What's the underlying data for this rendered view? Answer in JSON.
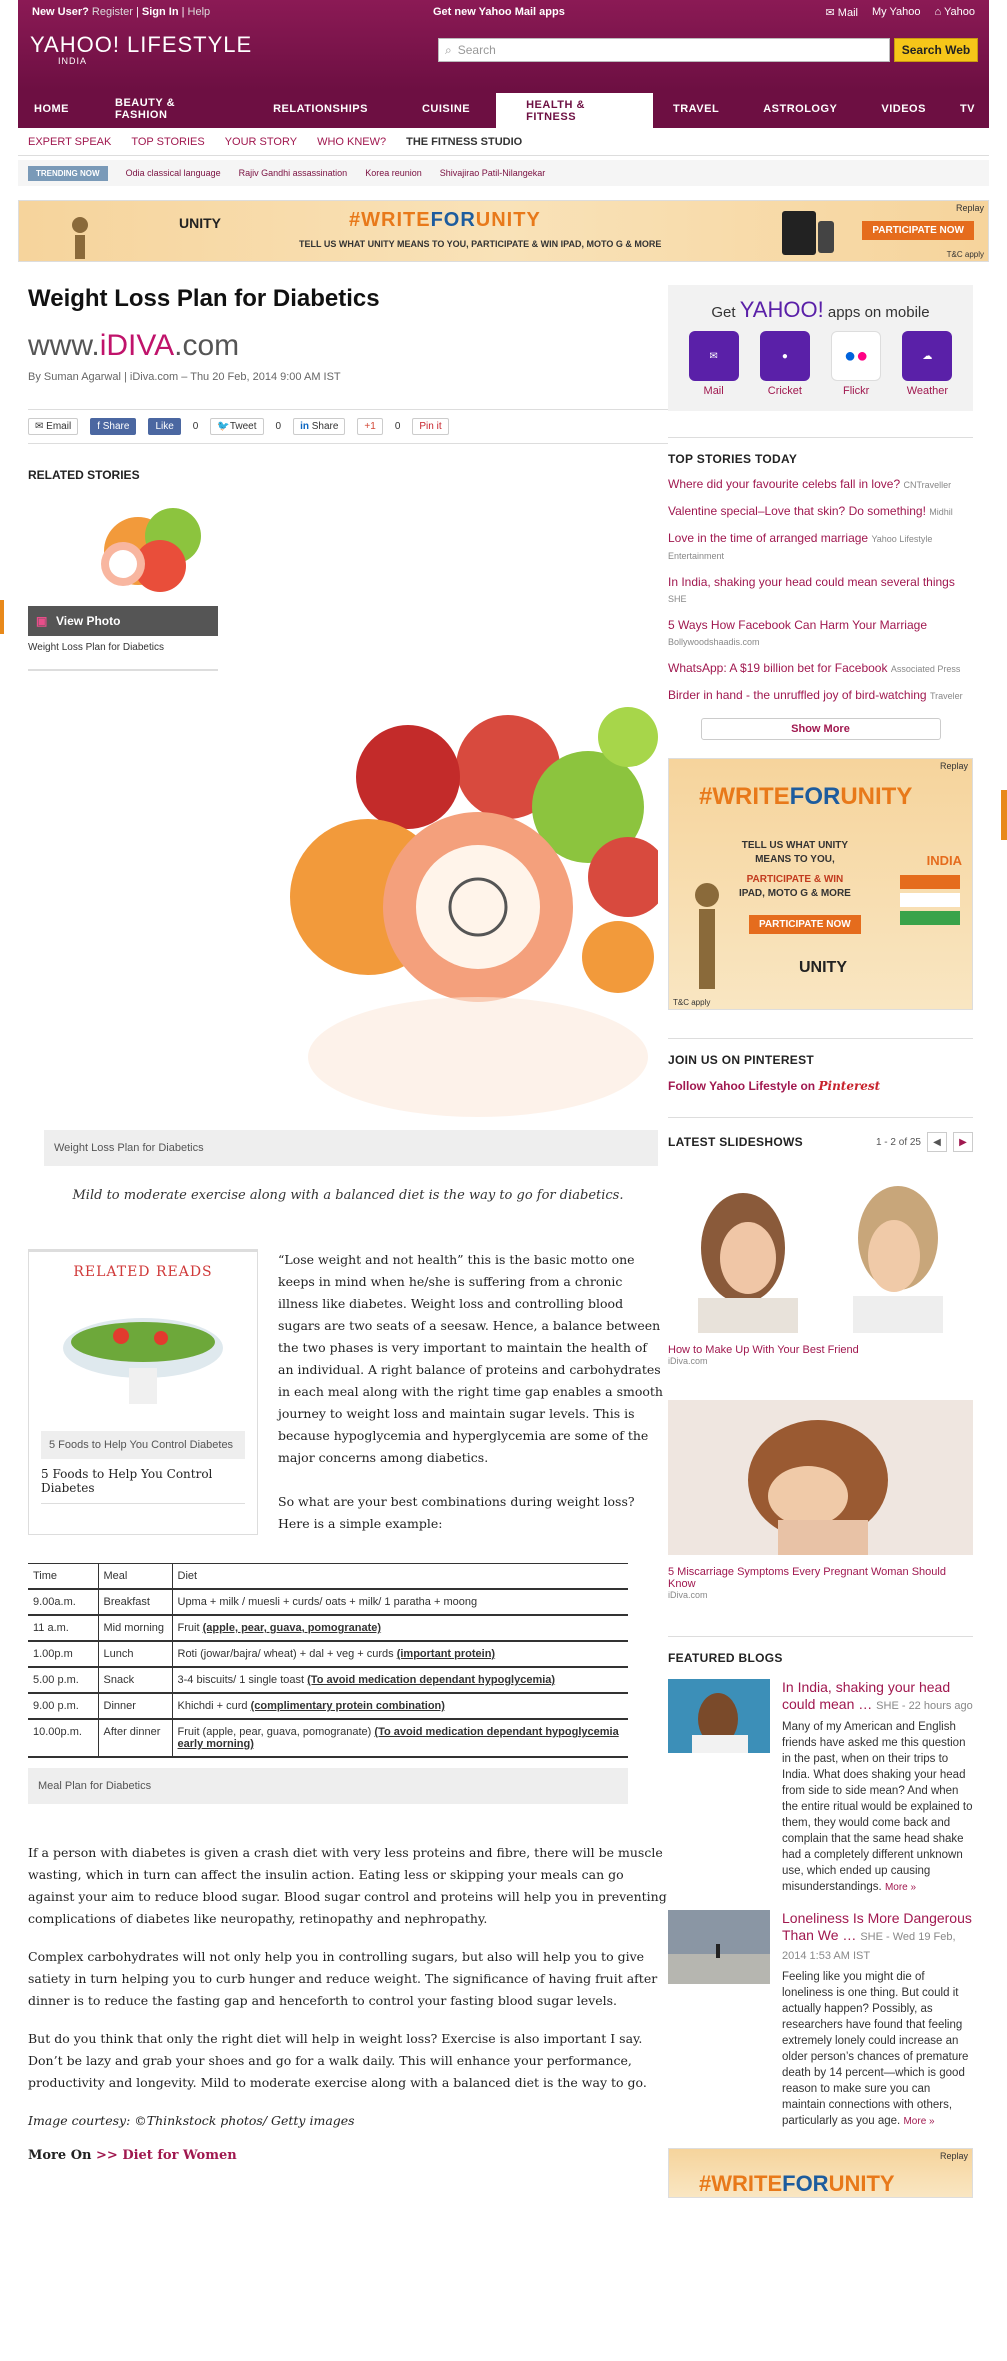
{
  "topbar": {
    "new_user": "New User?",
    "register": "Register",
    "sign_in": "Sign In",
    "help": "Help",
    "mail_promo": "Get new Yahoo Mail apps",
    "mail": "Mail",
    "my_yahoo": "My Yahoo",
    "yahoo": "Yahoo",
    "logo": "YAHOO! LIFESTYLE",
    "logo_sub": "INDIA",
    "search_placeholder": "Search",
    "search_button": "Search Web"
  },
  "nav": [
    "HOME",
    "BEAUTY & FASHION",
    "RELATIONSHIPS",
    "CUISINE",
    "HEALTH & FITNESS",
    "TRAVEL",
    "ASTROLOGY",
    "VIDEOS",
    "TV"
  ],
  "subnav": [
    "EXPERT SPEAK",
    "TOP STORIES",
    "YOUR STORY",
    "WHO KNEW?",
    "THE FITNESS STUDIO"
  ],
  "trending": {
    "label": "TRENDING NOW",
    "items": [
      "Odia classical language",
      "Rajiv Gandhi assassination",
      "Korea reunion",
      "Shivajirao Patil-Nilangekar"
    ]
  },
  "banner": {
    "unity": "UNITY",
    "write": "#WRITE",
    "for": "FOR",
    "unity2": "UNITY",
    "tagline": "TELL US WHAT UNITY MEANS TO YOU, PARTICIPATE & WIN IPAD, MOTO G & MORE",
    "cta": "PARTICIPATE NOW",
    "replay": "Replay",
    "tc": "T&C apply"
  },
  "article": {
    "title": "Weight Loss Plan for Diabetics",
    "source_www": "www.",
    "source_brand": "iDIVA",
    "source_com": ".com",
    "byline": "By Suman Agarwal | iDiva.com – Thu 20 Feb, 2014 9:00 AM IST",
    "share": {
      "email": "Email",
      "fb_share": "Share",
      "like": "Like",
      "like_count": "0",
      "tweet": "Tweet",
      "tweet_count": "0",
      "in_share": "Share",
      "gplus": "+1",
      "gplus_count": "0",
      "pin": "Pin it"
    },
    "related_stories": "RELATED STORIES",
    "view_photo": "View Photo",
    "thumb_caption": "Weight Loss Plan for Diabetics",
    "hero_caption": "Weight Loss Plan for Diabetics",
    "quote": "Mild to moderate exercise along with a balanced diet is the way to go for diabetics.",
    "related_reads": "RELATED READS",
    "rr_caption": "5 Foods to Help You Control Diabetes",
    "rr_title": "5 Foods to Help You Control Diabetes",
    "para1": "“Lose weight and not health” this is the basic motto one keeps in mind when he/she is suffering from a chronic illness like diabetes. Weight loss and controlling blood sugars are two seats of a seesaw. Hence, a balance between the two phases is very important to maintain the health of an individual. A right balance of proteins and carbohydrates in each meal along with the right time gap enables a smooth journey to weight loss and maintain sugar levels. This is because hypoglycemia and hyperglycemia are some of the major concerns among diabetics.",
    "para2": "So what are your best combinations during weight loss? Here is a simple example:",
    "table_head": [
      "Time",
      "Meal",
      "Diet"
    ],
    "table_rows": [
      {
        "time": "9.00a.m.",
        "meal": "Breakfast",
        "diet": "Upma + milk / muesli + curds/ oats + milk/ 1 paratha + moong",
        "note": ""
      },
      {
        "time": "11 a.m.",
        "meal": "Mid morning",
        "diet": "Fruit",
        "note": "(apple, pear, guava, pomogranate)"
      },
      {
        "time": "1.00p.m",
        "meal": "Lunch",
        "diet": "Roti (jowar/bajra/ wheat) + dal + veg + curds",
        "note": "(important protein)"
      },
      {
        "time": "5.00 p.m.",
        "meal": "Snack",
        "diet": "3-4 biscuits/ 1 single toast",
        "note": "(To avoid medication dependant hypoglycemia)"
      },
      {
        "time": "9.00 p.m.",
        "meal": "Dinner",
        "diet": "Khichdi + curd",
        "note": "(complimentary protein combination)"
      },
      {
        "time": "10.00p.m.",
        "meal": "After dinner",
        "diet": "Fruit (apple, pear, guava, pomogranate)",
        "note": "(To avoid medication dependant hypoglycemia early morning)"
      }
    ],
    "table_caption": "Meal Plan for Diabetics",
    "para3": "If a person with diabetes is given a crash diet with very less proteins and fibre, there will be muscle wasting, which in turn can affect the insulin action. Eating less or skipping your meals can go against your aim to reduce blood sugar. Blood sugar control and proteins will help you in preventing complications of diabetes like neuropathy, retinopathy and nephropathy.",
    "para4": "Complex carbohydrates will not only help you in controlling sugars, but also will help you to give satiety in turn helping you to curb hunger and reduce weight. The significance of having fruit after dinner is to reduce the fasting gap and henceforth to control your fasting blood sugar levels.",
    "para5": "But do you think that only the right diet will help in weight loss? Exercise is also important I say. Don’t be lazy and grab your shoes and go for a walk daily. This will enhance your performance, productivity and longevity. Mild to moderate exercise along with a balanced diet is the way to go.",
    "credit": "Image courtesy: ©Thinkstock photos/ Getty images",
    "more_on": "More On",
    "more_link": ">> Diet for Women"
  },
  "rail": {
    "apps_get": "Get",
    "apps_brand": "YAHOO!",
    "apps_on": "apps on mobile",
    "apps": [
      {
        "name": "Mail",
        "color": "#5a20a8"
      },
      {
        "name": "Cricket",
        "color": "#5a20a8"
      },
      {
        "name": "Flickr",
        "color": "#ffffff"
      },
      {
        "name": "Weather",
        "color": "#5a20a8"
      }
    ],
    "top_stories_title": "TOP STORIES TODAY",
    "stories": [
      {
        "title": "Where did your favourite celebs fall in love?",
        "src": "CNTraveller"
      },
      {
        "title": "Valentine special–Love that skin? Do something!",
        "src": "Midhil"
      },
      {
        "title": "Love in the time of arranged marriage",
        "src": "Yahoo Lifestyle Entertainment"
      },
      {
        "title": "In India, shaking your head could mean several things",
        "src": "SHE"
      },
      {
        "title": "5 Ways How Facebook Can Harm Your Marriage",
        "src": "Bollywoodshaadis.com"
      },
      {
        "title": "WhatsApp: A $19 billion bet for Facebook",
        "src": "Associated Press"
      },
      {
        "title": "Birder in hand - the unruffled joy of bird-watching",
        "src": "Traveler"
      }
    ],
    "show_more": "Show More",
    "ad": {
      "replay": "Replay",
      "write": "#WRITE",
      "for": "FOR",
      "unity": "UNITY",
      "line1": "TELL US WHAT UNITY",
      "line2": "MEANS TO YOU,",
      "line3": "PARTICIPATE & WIN",
      "line4": "IPAD, MOTO G & MORE",
      "cta": "PARTICIPATE NOW",
      "india": "INDIA",
      "brand": "UNITY",
      "tc": "T&C apply"
    },
    "pinterest_title": "JOIN US ON PINTEREST",
    "pinterest_follow": "Follow Yahoo Lifestyle on",
    "pinterest_brand": "Pinterest",
    "slides_title": "LATEST SLIDESHOWS",
    "slides_page": "1 - 2 of 25",
    "slides": [
      {
        "title": "How to Make Up With Your Best Friend",
        "src": "iDiva.com"
      },
      {
        "title": "5 Miscarriage Symptoms Every Pregnant Woman Should Know",
        "src": "iDiva.com"
      }
    ],
    "blogs_title": "FEATURED BLOGS",
    "blogs": [
      {
        "title": "In India, shaking your head could mean …",
        "meta": "SHE - 22 hours ago",
        "text": "Many of my American and English friends have asked me this question in the past, when on their trips to India. What does shaking your head from side to side mean? And when the entire ritual would be explained to them, they would come back and complain that the same head shake had a completely different unknown use, which ended up causing misunderstandings.",
        "more": "More »"
      },
      {
        "title": "Loneliness Is More Dangerous Than We …",
        "meta": "SHE - Wed 19 Feb, 2014 1:53 AM IST",
        "text": "Feeling like you might die of loneliness is one thing. But could it actually happen? Possibly, as researchers have found that feeling extremely lonely could increase an older person’s chances of premature death by 14 percent—which is good reason to make sure you can maintain connections with others, particularly as you age.",
        "more": "More »"
      }
    ],
    "ad3": {
      "replay": "Replay",
      "write": "#WRITE",
      "for": "FOR",
      "unity": "UNITY"
    }
  }
}
